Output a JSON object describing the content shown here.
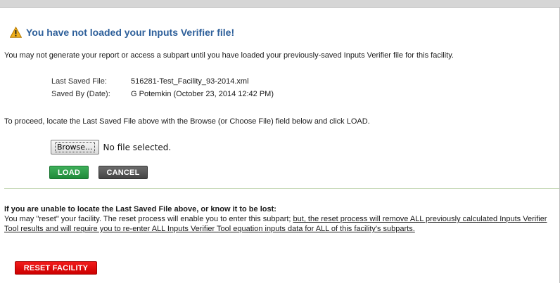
{
  "warning": {
    "title": "You have not loaded your Inputs Verifier file!",
    "icon": "warning-icon",
    "icon_color": "#e8a317"
  },
  "intro_text": "You may not generate your report or access a subpart until you have loaded your previously-saved Inputs Verifier file for this facility.",
  "saved_info": {
    "last_saved_label": "Last Saved File:",
    "last_saved_value": "516281-Test_Facility_93-2014.xml",
    "saved_by_label": "Saved By (Date):",
    "saved_by_value": "G Potemkin (October 23, 2014 12:42 PM)"
  },
  "proceed_text": "To proceed, locate the Last Saved File above with the Browse (or Choose File) field below and click LOAD.",
  "file_input": {
    "browse_label": "Browse...",
    "status": "No file selected."
  },
  "actions": {
    "load_label": "LOAD",
    "cancel_label": "CANCEL",
    "load_color": "#2a9b48",
    "cancel_color": "#555555"
  },
  "reset_section": {
    "heading": "If you are unable to locate the Last Saved File above, or know it to be lost:",
    "text_plain": "You may \"reset\" your facility. The reset process will enable you to enter this subpart; ",
    "text_underlined": "but, the reset process will remove ALL previously calculated Inputs Verifier Tool results and will require you to re-enter ALL Inputs Verifier Tool equation inputs data for ALL of this facility's subparts.",
    "button_label": "RESET FACILITY",
    "button_color": "#e00000"
  }
}
